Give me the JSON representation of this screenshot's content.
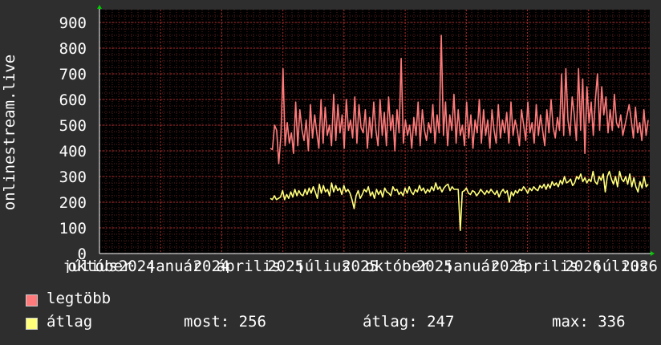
{
  "chart_data": {
    "type": "line",
    "ylabel": "onlinestream.live",
    "ylim": [
      0,
      950
    ],
    "yticks": [
      0,
      100,
      200,
      300,
      400,
      500,
      600,
      700,
      800,
      900
    ],
    "xtick_labels": [
      "július",
      "október",
      "2024",
      "január",
      "2024",
      "április",
      "2025",
      "július",
      "2025",
      "október",
      "2025",
      "január",
      "2025",
      "április",
      "2026",
      "július",
      "2026"
    ],
    "grid": true,
    "colors": {
      "background": "#2e2e2e",
      "plot_bg": "#000000",
      "grid_minor": "#5a2020",
      "grid_major": "#aa2a2a",
      "axis": "#ffffff",
      "arrow": "#00cc00"
    },
    "series": [
      {
        "name": "legtöbb",
        "color": "#ff7b7b",
        "values": [
          410,
          405,
          500,
          480,
          350,
          460,
          720,
          420,
          510,
          430,
          470,
          390,
          590,
          420,
          560,
          480,
          440,
          520,
          400,
          580,
          450,
          540,
          470,
          410,
          600,
          430,
          570,
          460,
          500,
          420,
          620,
          440,
          580,
          470,
          540,
          410,
          600,
          480,
          520,
          450,
          610,
          430,
          580,
          490,
          470,
          560,
          410,
          530,
          450,
          590,
          480,
          420,
          600,
          460,
          550,
          420,
          610,
          480,
          540,
          400,
          560,
          470,
          760,
          430,
          520,
          460,
          500,
          410,
          530,
          460,
          590,
          420,
          560,
          480,
          440,
          510,
          470,
          580,
          430,
          540,
          470,
          850,
          460,
          590,
          420,
          540,
          480,
          620,
          430,
          560,
          460,
          500,
          420,
          590,
          450,
          540,
          410,
          520,
          470,
          600,
          430,
          560,
          460,
          520,
          410,
          560,
          480,
          430,
          580,
          450,
          520,
          470,
          550,
          430,
          590,
          460,
          520,
          480,
          420,
          560,
          500,
          440,
          590,
          470,
          510,
          430,
          580,
          460,
          540,
          480,
          420,
          560,
          470,
          600,
          490,
          450,
          530,
          480,
          700,
          460,
          720,
          520,
          460,
          610,
          540,
          440,
          720,
          480,
          680,
          390,
          650,
          510,
          590,
          460,
          600,
          700,
          480,
          650,
          540,
          610,
          470,
          560,
          480,
          620,
          510,
          490,
          540,
          460,
          500,
          540,
          580,
          520,
          450,
          570,
          470,
          510,
          440,
          560,
          460,
          520
        ]
      },
      {
        "name": "átlag",
        "color": "#ffff7a",
        "values": [
          215,
          210,
          225,
          210,
          215,
          220,
          245,
          210,
          230,
          215,
          240,
          220,
          250,
          225,
          245,
          230,
          225,
          250,
          230,
          255,
          235,
          260,
          240,
          215,
          270,
          235,
          265,
          240,
          250,
          225,
          275,
          240,
          265,
          245,
          255,
          230,
          265,
          240,
          250,
          235,
          210,
          175,
          225,
          245,
          215,
          230,
          250,
          240,
          260,
          225,
          240,
          215,
          250,
          230,
          245,
          220,
          255,
          240,
          235,
          225,
          260,
          245,
          250,
          230,
          240,
          225,
          255,
          235,
          260,
          240,
          230,
          250,
          240,
          265,
          245,
          255,
          235,
          250,
          240,
          260,
          245,
          275,
          250,
          260,
          240,
          255,
          265,
          270,
          245,
          260,
          250,
          250,
          250,
          90,
          240,
          245,
          255,
          235,
          230,
          245,
          240,
          225,
          235,
          250,
          240,
          230,
          245,
          235,
          250,
          240,
          230,
          245,
          220,
          240,
          250,
          235,
          245,
          200,
          240,
          225,
          245,
          235,
          250,
          245,
          260,
          250,
          235,
          255,
          245,
          260,
          250,
          245,
          265,
          255,
          270,
          250,
          270,
          255,
          280,
          265,
          275,
          260,
          285,
          270,
          300,
          275,
          280,
          290,
          265,
          275,
          300,
          290,
          310,
          280,
          295,
          275,
          290,
          280,
          320,
          280,
          270,
          300,
          285,
          310,
          240,
          300,
          320,
          290,
          270,
          300,
          260,
          320,
          290,
          280,
          300,
          270,
          310,
          260,
          295,
          260,
          240,
          280,
          255,
          300,
          260,
          270
        ]
      }
    ]
  },
  "legend": {
    "items": [
      {
        "label": "legtöbb",
        "color": "#ff7b7b"
      },
      {
        "label": "átlag",
        "color": "#ffff7a"
      }
    ],
    "stats": {
      "most": "most: 256",
      "atlag": "átlag: 247",
      "max": "max: 336"
    }
  }
}
